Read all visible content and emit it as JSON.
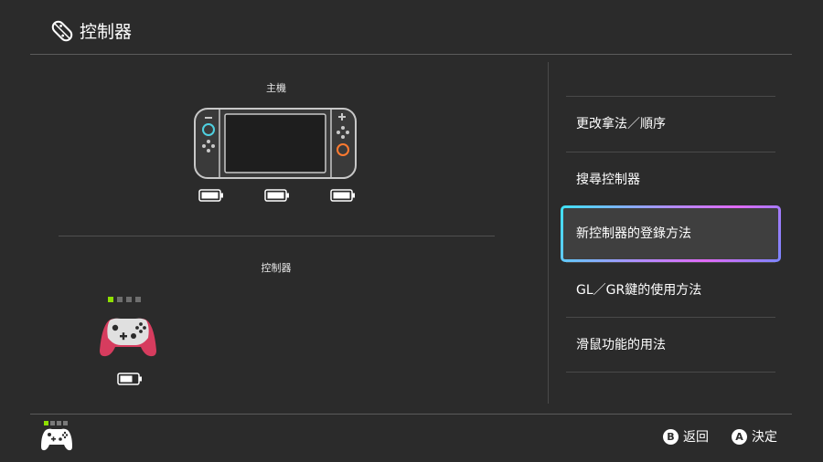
{
  "header": {
    "title": "控制器",
    "icon": "joycon-icon"
  },
  "console_section": {
    "label": "主機",
    "batteries": 3
  },
  "controllers_section": {
    "label": "控制器",
    "player_lights": [
      true,
      false,
      false,
      false
    ],
    "controller_icon": "pro-controller-icon"
  },
  "menu": {
    "items": [
      {
        "label": "更改拿法／順序"
      },
      {
        "label": "搜尋控制器"
      },
      {
        "label": "新控制器的登錄方法"
      },
      {
        "label": "GL／GR鍵的使用方法"
      },
      {
        "label": "滑鼠功能的用法"
      }
    ],
    "selected_index": 2
  },
  "footer": {
    "back": {
      "button": "B",
      "label": "返回"
    },
    "ok": {
      "button": "A",
      "label": "決定"
    }
  },
  "colors": {
    "background": "#2b2b2b",
    "player_light_on": "#8ee000",
    "selection_gradient": [
      "#3ee3f6",
      "#b48bff",
      "#e06af5"
    ],
    "pro_controller_grip": "#d63c5e",
    "joycon_left_accent": "#4fd0e0",
    "joycon_right_accent": "#ff7a30"
  }
}
